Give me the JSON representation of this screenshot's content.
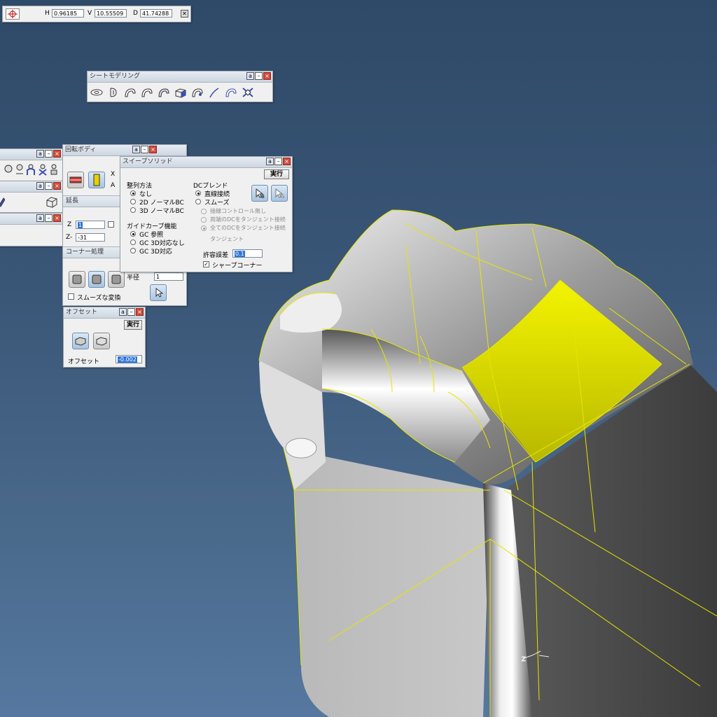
{
  "coord_bar": {
    "h_label": "H",
    "h_value": "0.96185",
    "v_label": "V",
    "v_value": "10.55509",
    "d_label": "D",
    "d_value": "41.74288",
    "close": "✕"
  },
  "sheet_modeling": {
    "title": "シートモデリング"
  },
  "revolve_body": {
    "title": "回転ボディ",
    "x_label": "X",
    "a_label": "A"
  },
  "extend": {
    "title": "延長",
    "z_label": "Z",
    "z_value": "1",
    "zminus_label": "Z-",
    "zminus_value": "-31"
  },
  "corner": {
    "title": "コーナー処理",
    "radius_label": "半径",
    "radius_value": "1",
    "smooth_label": "スムーズな変換"
  },
  "offset": {
    "title": "オフセット",
    "execute": "実行",
    "offset_label": "オフセット",
    "offset_value": "-0.002"
  },
  "sweep": {
    "title": "スイープソリッド",
    "execute": "実行",
    "align_label": "整列方法",
    "align_options": [
      "なし",
      "2D ノーマルBC",
      "3D ノーマルBC"
    ],
    "guide_label": "ガイドカーブ機能",
    "guide_options": [
      "GC 参照",
      "GC 3D対応なし",
      "GC 3D対応"
    ],
    "dc_label": "DCブレンド",
    "dc_options": [
      "直線接続",
      "スムーズ"
    ],
    "tangent_options": [
      "接線コントロール無し",
      "両端のDCをタンジェント接続",
      "全てのDCをタンジェント接続"
    ],
    "tangent_label": "タンジェント",
    "tolerance_label": "許容誤差",
    "tolerance_value": "0.1",
    "sharp_label": "シャープコーナー"
  },
  "colors": {
    "highlight": "#f2f200",
    "edge": "#e6e600",
    "background_top": "#2f4a68",
    "background_bottom": "#5678a0"
  }
}
